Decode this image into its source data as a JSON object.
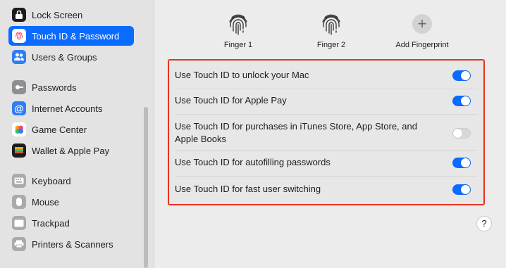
{
  "sidebar": {
    "items": [
      {
        "label": "Lock Screen",
        "icon": "lock-icon",
        "color": "#1c1c1e"
      },
      {
        "label": "Touch ID & Password",
        "icon": "fingerprint-icon",
        "color": "#ffffff",
        "selected": true
      },
      {
        "label": "Users & Groups",
        "icon": "users-icon",
        "color": "#2f7cf6"
      },
      {
        "label": "Passwords",
        "icon": "key-icon",
        "color": "#8e8e93"
      },
      {
        "label": "Internet Accounts",
        "icon": "at-icon",
        "color": "#2f7cf6"
      },
      {
        "label": "Game Center",
        "icon": "game-center-icon",
        "color": "#ffffff"
      },
      {
        "label": "Wallet & Apple Pay",
        "icon": "wallet-icon",
        "color": "#1c1c1e"
      },
      {
        "label": "Keyboard",
        "icon": "keyboard-icon",
        "color": "#8e8e93"
      },
      {
        "label": "Mouse",
        "icon": "mouse-icon",
        "color": "#8e8e93"
      },
      {
        "label": "Trackpad",
        "icon": "trackpad-icon",
        "color": "#8e8e93"
      },
      {
        "label": "Printers & Scanners",
        "icon": "printer-icon",
        "color": "#8e8e93"
      }
    ]
  },
  "fingerprints": {
    "finger1": "Finger 1",
    "finger2": "Finger 2",
    "add": "Add Fingerprint"
  },
  "settings": [
    {
      "label": "Use Touch ID to unlock your Mac",
      "enabled": true
    },
    {
      "label": "Use Touch ID for Apple Pay",
      "enabled": true
    },
    {
      "label": "Use Touch ID for purchases in iTunes Store, App Store, and Apple Books",
      "enabled": false
    },
    {
      "label": "Use Touch ID for autofilling passwords",
      "enabled": true
    },
    {
      "label": "Use Touch ID for fast user switching",
      "enabled": true
    }
  ],
  "help_label": "?",
  "colors": {
    "accent": "#0a6cff",
    "highlight_border": "#e8321f"
  }
}
